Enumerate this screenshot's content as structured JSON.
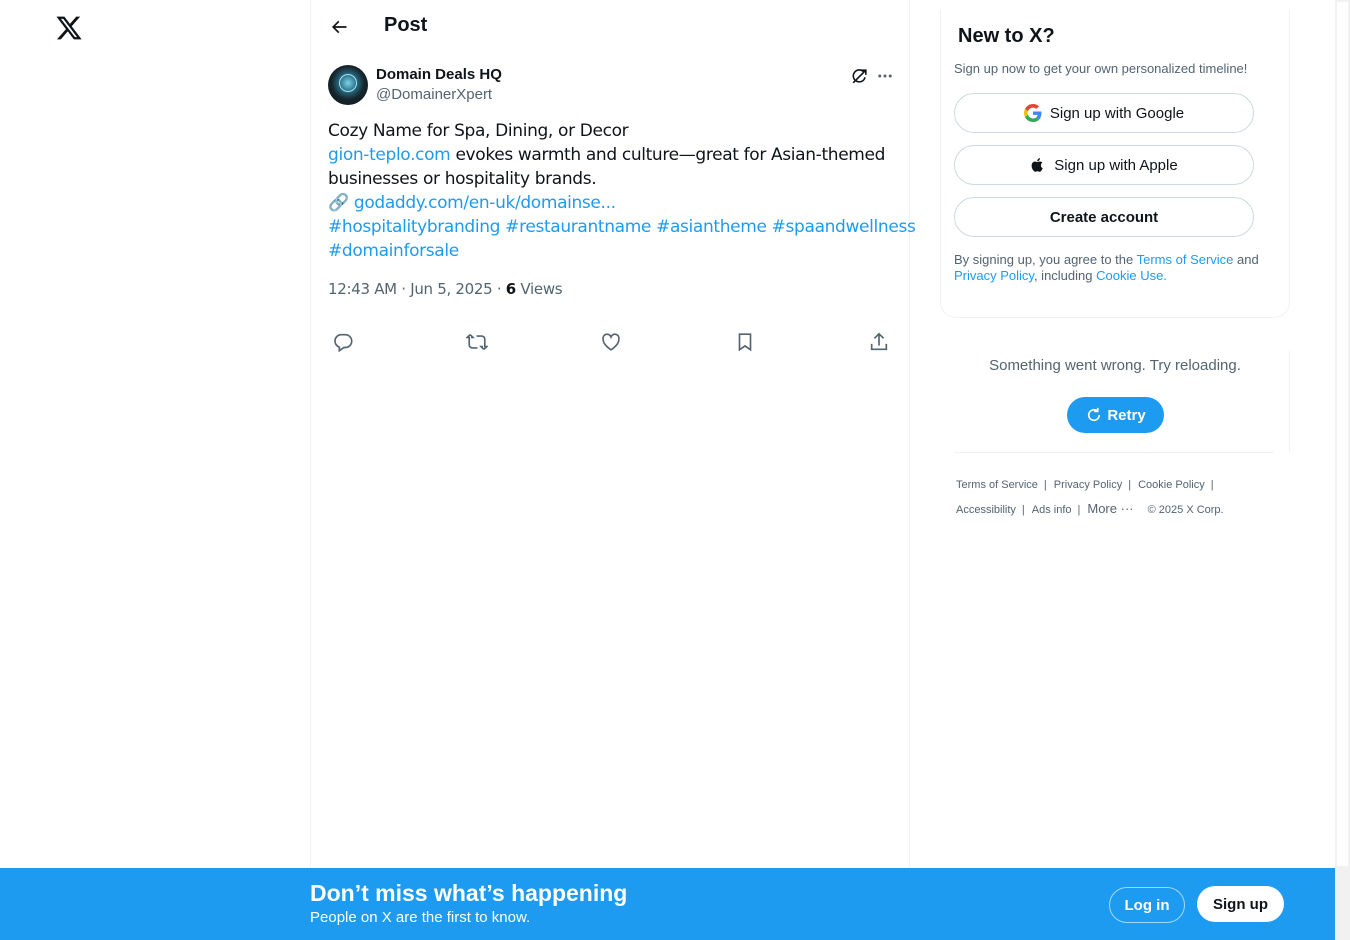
{
  "header": {
    "title": "Post"
  },
  "post": {
    "author_name": "Domain Deals HQ",
    "author_handle": "@DomainerXpert",
    "body": {
      "line1": "Cozy Name for Spa, Dining, or Decor",
      "domain_link": "gion-teplo.com",
      "line2_rest": " evokes warmth and culture—great for Asian-themed",
      "line3": "businesses or hospitality brands.",
      "link_emoji": "🔗",
      "url": "godaddy.com/en-uk/domainse...",
      "hashtags_line1": [
        "#hospitalitybranding",
        "#restaurantname",
        "#asiantheme",
        "#spaandwellness"
      ],
      "hashtags_line2": [
        "#domainforsale"
      ]
    },
    "time": "12:43 AM · Jun 5, 2025 · ",
    "views_count": "6",
    "views_label": " Views"
  },
  "signup": {
    "title": "New to X?",
    "subtitle": "Sign up now to get your own personalized timeline!",
    "google_label": "Sign up with Google",
    "apple_label": "Sign up with Apple",
    "create_label": "Create account",
    "terms_prefix": "By signing up, you agree to the ",
    "terms_link": "Terms of Service",
    "terms_and": " and ",
    "privacy_link": "Privacy Policy",
    "terms_including": ", including ",
    "cookie_link": "Cookie Use."
  },
  "error": {
    "message": "Something went wrong. Try reloading.",
    "retry_label": "Retry"
  },
  "footer": {
    "terms": "Terms of Service",
    "privacy": "Privacy Policy",
    "cookie": "Cookie Policy",
    "accessibility": "Accessibility",
    "ads": "Ads info",
    "more": "More",
    "more_icon": "···",
    "copyright": "© 2025 X Corp.",
    "separator": "|"
  },
  "bottom_bar": {
    "title": "Don’t miss what’s happening",
    "subtitle": "People on X are the first to know.",
    "login_label": "Log in",
    "signup_label": "Sign up"
  },
  "colors": {
    "accent": "#1d9bf0",
    "text": "#0f1419",
    "muted": "#536471",
    "border": "#eff3f4"
  },
  "icons": {
    "logo": "x-logo-icon",
    "back": "arrow-left-icon",
    "grok": "grok-icon",
    "more": "ellipsis-icon",
    "reply": "reply-icon",
    "repost": "repost-icon",
    "like": "heart-icon",
    "bookmark": "bookmark-icon",
    "share": "share-icon",
    "google": "google-icon",
    "apple": "apple-icon",
    "retry": "refresh-icon"
  }
}
